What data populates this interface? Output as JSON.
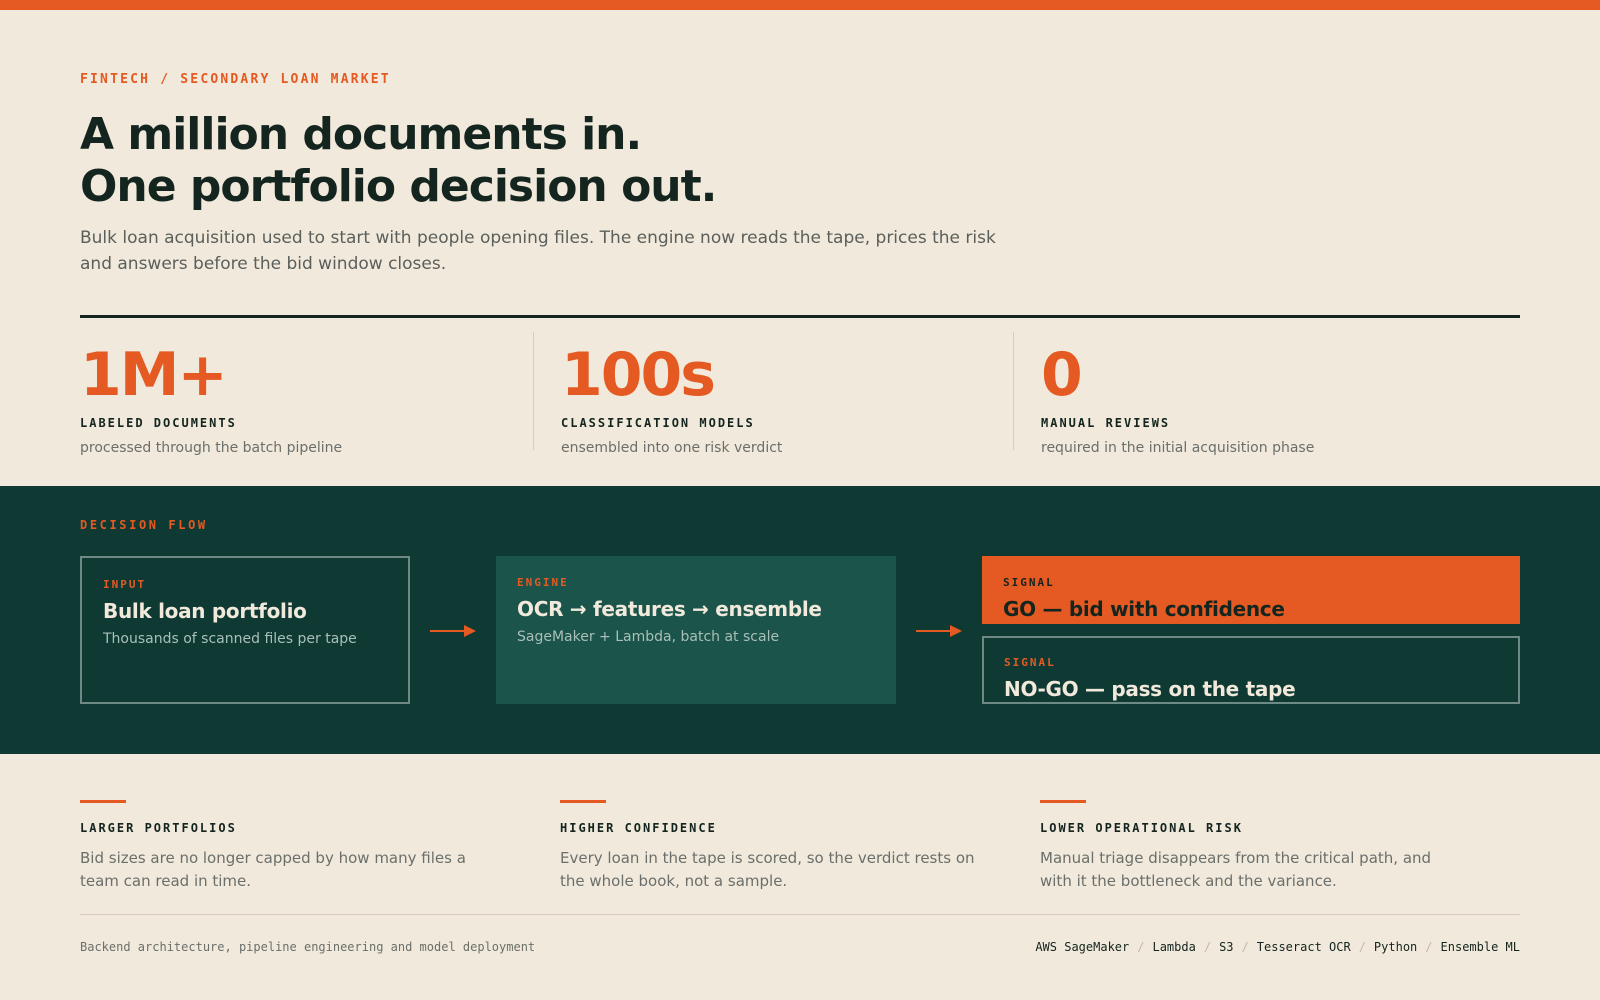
{
  "colors": {
    "accent": "#e45a22",
    "ink": "#14251f",
    "paper": "#f1e9db",
    "panel": "#0f3a34",
    "panel_raised": "#1b544b"
  },
  "hero": {
    "eyebrow": "FINTECH / SECONDARY LOAN MARKET",
    "headline_line1": "A million documents in.",
    "headline_line2": "One portfolio decision out.",
    "lede": "Bulk loan acquisition used to start with people opening files. The engine now reads the tape, prices the risk and answers before the bid window closes."
  },
  "stats": [
    {
      "value": "1M+",
      "label": "LABELED DOCUMENTS",
      "desc": "processed through the batch pipeline"
    },
    {
      "value": "100s",
      "label": "CLASSIFICATION MODELS",
      "desc": "ensembled into one risk verdict"
    },
    {
      "value": "0",
      "label": "MANUAL REVIEWS",
      "desc": "required in the initial acquisition phase"
    }
  ],
  "flow": {
    "eyebrow": "DECISION FLOW",
    "input": {
      "tag": "INPUT",
      "title": "Bulk loan portfolio",
      "sub": "Thousands of scanned files per tape"
    },
    "engine": {
      "tag": "ENGINE",
      "title": "OCR → features → ensemble",
      "sub": "SageMaker + Lambda, batch at scale"
    },
    "go": {
      "tag": "SIGNAL",
      "title": "GO — bid with confidence"
    },
    "nogo": {
      "tag": "SIGNAL",
      "title": "NO-GO — pass on the tape"
    }
  },
  "benefits": [
    {
      "title": "LARGER PORTFOLIOS",
      "text": "Bid sizes are no longer capped by how many files a team can read in time."
    },
    {
      "title": "HIGHER CONFIDENCE",
      "text": "Every loan in the tape is scored, so the verdict rests on the whole book, not a sample."
    },
    {
      "title": "LOWER OPERATIONAL RISK",
      "text": "Manual triage disappears from the critical path, and with it the bottleneck and the variance."
    }
  ],
  "footer": {
    "note": "Backend architecture, pipeline engineering and model deployment",
    "stack": [
      "AWS SageMaker",
      "Lambda",
      "S3",
      "Tesseract OCR",
      "Python",
      "Ensemble ML"
    ],
    "separator": "/"
  }
}
